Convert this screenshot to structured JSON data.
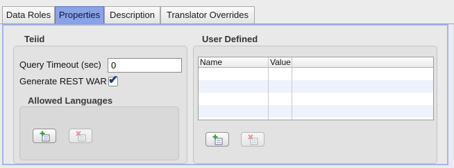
{
  "tabs": [
    {
      "label": "Data Roles",
      "active": false
    },
    {
      "label": "Properties",
      "active": true
    },
    {
      "label": "Description",
      "active": false
    },
    {
      "label": "Translator Overrides",
      "active": false
    }
  ],
  "teiid": {
    "title": "Teiid",
    "query_timeout_label": "Query Timeout (sec)",
    "query_timeout_value": "0",
    "generate_rest_war_label": "Generate REST WAR",
    "generate_rest_war_checked": true,
    "allowed_languages": {
      "title": "Allowed Languages",
      "add_icon": "add-row-icon",
      "remove_icon": "remove-row-icon"
    }
  },
  "user_defined": {
    "title": "User Defined",
    "columns": [
      "Name",
      "Value"
    ],
    "rows": [],
    "add_icon": "add-row-icon",
    "remove_icon": "remove-row-icon"
  },
  "colors": {
    "active_tab": "#8aa2e6",
    "content_border": "#9fb6ea",
    "add_green": "#3aa53a",
    "remove_red": "#d94a4a"
  }
}
